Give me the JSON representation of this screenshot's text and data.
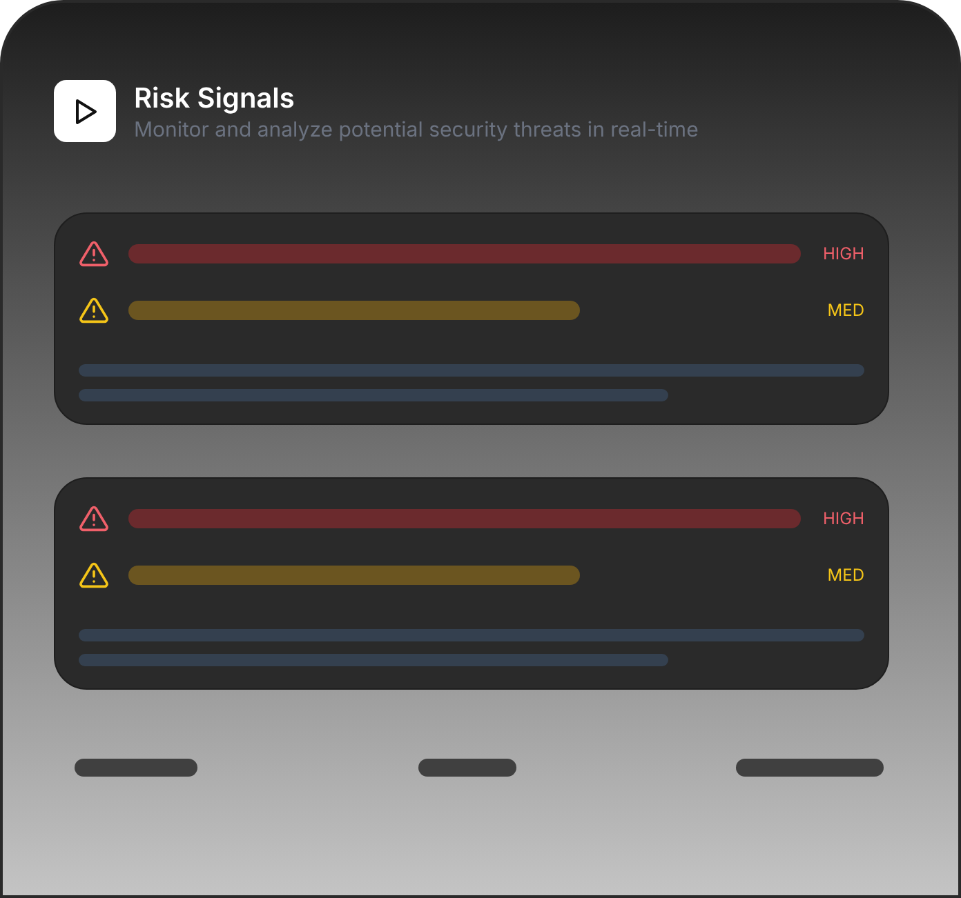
{
  "header": {
    "title": "Risk Signals",
    "subtitle": "Monitor and analyze potential security threats in real-time"
  },
  "cards": [
    {
      "signals": [
        {
          "kind": "high",
          "label": "HIGH"
        },
        {
          "kind": "med",
          "label": "MED"
        }
      ]
    },
    {
      "signals": [
        {
          "kind": "high",
          "label": "HIGH"
        },
        {
          "kind": "med",
          "label": "MED"
        }
      ]
    }
  ]
}
